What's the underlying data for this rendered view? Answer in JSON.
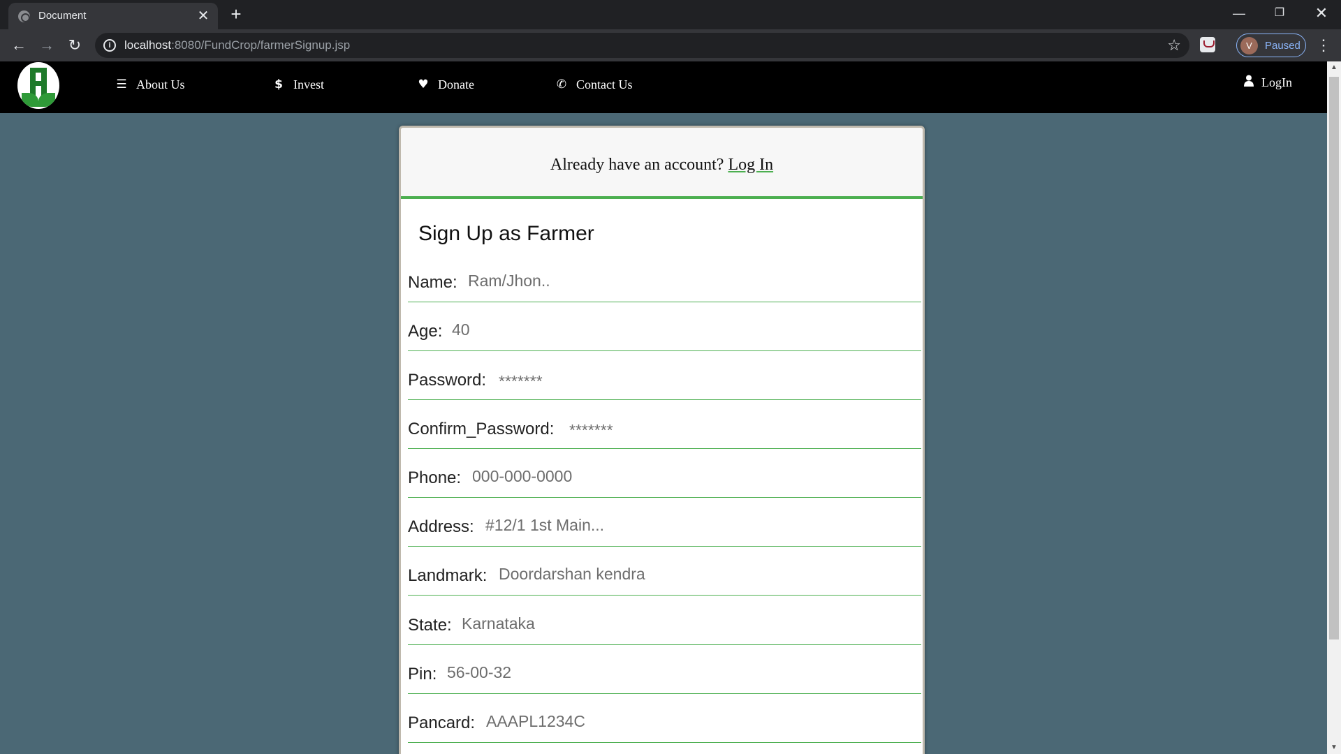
{
  "browser": {
    "tab_title": "Document",
    "url_host": "localhost",
    "url_rest": ":8080/FundCrop/farmerSignup.jsp",
    "profile_initial": "V",
    "profile_status": "Paused"
  },
  "nav": {
    "items": [
      {
        "label": "About Us",
        "icon": "list-icon"
      },
      {
        "label": "Invest",
        "icon": "dollar-icon"
      },
      {
        "label": "Donate",
        "icon": "heart-icon"
      },
      {
        "label": "Contact Us",
        "icon": "phone-icon"
      }
    ],
    "login": {
      "label": "LogIn",
      "icon": "user-icon"
    }
  },
  "card": {
    "already_text": "Already have an account?",
    "login_link": "Log In",
    "title": "Sign Up as Farmer",
    "fields": [
      {
        "label": "Name:",
        "value": "Ram/Jhon.."
      },
      {
        "label": "Age:",
        "value": "40"
      },
      {
        "label": "Password:",
        "value": "*******"
      },
      {
        "label": "Confirm_Password:",
        "value": "*******"
      },
      {
        "label": "Phone:",
        "value": "000-000-0000"
      },
      {
        "label": "Address:",
        "value": "#12/1 1st Main..."
      },
      {
        "label": "Landmark:",
        "value": "Doordarshan kendra"
      },
      {
        "label": "State:",
        "value": "Karnataka"
      },
      {
        "label": "Pin:",
        "value": "56-00-32"
      },
      {
        "label": "Pancard:",
        "value": "AAAPL1234C"
      }
    ]
  },
  "colors": {
    "accent": "#4caf50",
    "page_bg": "#4b6875",
    "nav_bg": "#000000"
  }
}
